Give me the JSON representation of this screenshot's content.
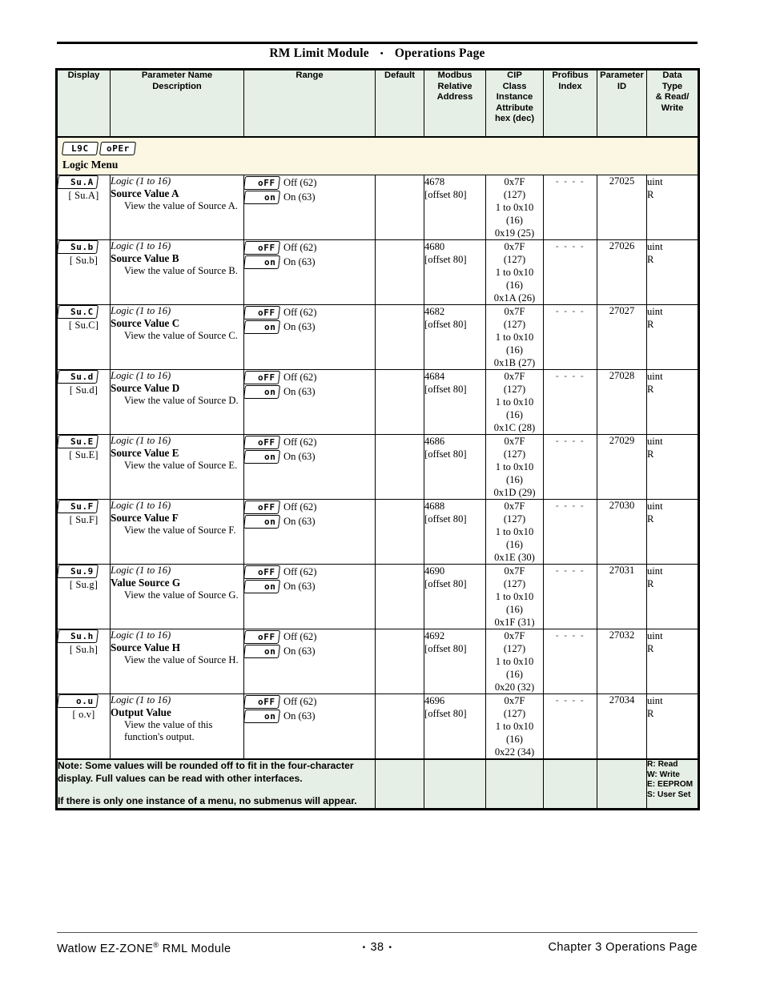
{
  "header": {
    "title_left": "RM Limit Module",
    "title_sep": "•",
    "title_right": "Operations Page"
  },
  "table": {
    "columns": [
      {
        "id": "display",
        "label": "Display"
      },
      {
        "id": "param",
        "label_line1": "Parameter Name",
        "label_line2": "Description"
      },
      {
        "id": "range",
        "label": "Range"
      },
      {
        "id": "default",
        "label": "Default"
      },
      {
        "id": "modbus",
        "label_line1": "Modbus",
        "label_line2": "Relative",
        "label_line3": "Address"
      },
      {
        "id": "cip",
        "label_line1": "CIP",
        "label_line2": "Class",
        "label_line3": "Instance",
        "label_line4": "Attribute",
        "label_line5": "hex (dec)"
      },
      {
        "id": "profibus",
        "label_line1": "Profibus",
        "label_line2": "Index"
      },
      {
        "id": "pid",
        "label_line1": "Parameter",
        "label_line2": "ID"
      },
      {
        "id": "dtype",
        "label_line1": "Data",
        "label_line2": "Type",
        "label_line3": "& Read/",
        "label_line4": "Write"
      }
    ],
    "menu_band": {
      "lcd_top": "L9C",
      "lcd_bottom": "oPEr",
      "label": "Logic Menu"
    },
    "rows": [
      {
        "lcd": "Su.A",
        "alt": "[ Su.A]",
        "logic": "Logic (1 to 16)",
        "name": "Source Value A",
        "desc": "View the value of Source A.",
        "range": [
          {
            "lcd": "oFF",
            "text": "Off (62)"
          },
          {
            "lcd": "on",
            "text": "On (63)"
          }
        ],
        "default": "",
        "modbus_address": "4678",
        "modbus_offset": "[offset 80]",
        "cip": [
          "0x7F",
          "(127)",
          "1 to 0x10",
          "(16)",
          "0x19 (25)"
        ],
        "profibus": "- - - -",
        "parameter_id": "27025",
        "dtype": "uint",
        "rw": "R"
      },
      {
        "lcd": "Su.b",
        "alt": "[ Su.b]",
        "logic": "Logic (1 to 16)",
        "name": "Source Value B",
        "desc": "View the value of Source B.",
        "range": [
          {
            "lcd": "oFF",
            "text": "Off (62)"
          },
          {
            "lcd": "on",
            "text": "On (63)"
          }
        ],
        "default": "",
        "modbus_address": "4680",
        "modbus_offset": "[offset 80]",
        "cip": [
          "0x7F",
          "(127)",
          "1 to 0x10",
          "(16)",
          "0x1A (26)"
        ],
        "profibus": "- - - -",
        "parameter_id": "27026",
        "dtype": "uint",
        "rw": "R"
      },
      {
        "lcd": "Su.C",
        "alt": "[ Su.C]",
        "logic": "Logic (1 to 16)",
        "name": "Source Value C",
        "desc": "View the value of Source C.",
        "range": [
          {
            "lcd": "oFF",
            "text": "Off (62)"
          },
          {
            "lcd": "on",
            "text": "On (63)"
          }
        ],
        "default": "",
        "modbus_address": "4682",
        "modbus_offset": "[offset 80]",
        "cip": [
          "0x7F",
          "(127)",
          "1 to 0x10",
          "(16)",
          "0x1B (27)"
        ],
        "profibus": "- - - -",
        "parameter_id": "27027",
        "dtype": "uint",
        "rw": "R"
      },
      {
        "lcd": "Su.d",
        "alt": "[ Su.d]",
        "logic": "Logic (1 to 16)",
        "name": "Source Value D",
        "desc": "View the value of Source D.",
        "range": [
          {
            "lcd": "oFF",
            "text": "Off (62)"
          },
          {
            "lcd": "on",
            "text": "On (63)"
          }
        ],
        "default": "",
        "modbus_address": "4684",
        "modbus_offset": "[offset 80]",
        "cip": [
          "0x7F",
          "(127)",
          "1 to 0x10",
          "(16)",
          "0x1C (28)"
        ],
        "profibus": "- - - -",
        "parameter_id": "27028",
        "dtype": "uint",
        "rw": "R"
      },
      {
        "lcd": "Su.E",
        "alt": "[ Su.E]",
        "logic": "Logic (1 to 16)",
        "name": "Source Value E",
        "desc": "View the value of Source E.",
        "range": [
          {
            "lcd": "oFF",
            "text": "Off (62)"
          },
          {
            "lcd": "on",
            "text": "On (63)"
          }
        ],
        "default": "",
        "modbus_address": "4686",
        "modbus_offset": "[offset 80]",
        "cip": [
          "0x7F",
          "(127)",
          "1 to 0x10",
          "(16)",
          "0x1D (29)"
        ],
        "profibus": "- - - -",
        "parameter_id": "27029",
        "dtype": "uint",
        "rw": "R"
      },
      {
        "lcd": "Su.F",
        "alt": "[ Su.F]",
        "logic": "Logic (1 to 16)",
        "name": "Source Value F",
        "desc": "View the value of Source F.",
        "range": [
          {
            "lcd": "oFF",
            "text": "Off (62)"
          },
          {
            "lcd": "on",
            "text": "On (63)"
          }
        ],
        "default": "",
        "modbus_address": "4688",
        "modbus_offset": "[offset 80]",
        "cip": [
          "0x7F",
          "(127)",
          "1 to 0x10",
          "(16)",
          "0x1E (30)"
        ],
        "profibus": "- - - -",
        "parameter_id": "27030",
        "dtype": "uint",
        "rw": "R"
      },
      {
        "lcd": "Su.9",
        "alt": "[ Su.g]",
        "logic": "Logic (1 to 16)",
        "name": "Value Source G",
        "desc": "View the value of Source G.",
        "range": [
          {
            "lcd": "oFF",
            "text": "Off (62)"
          },
          {
            "lcd": "on",
            "text": "On (63)"
          }
        ],
        "default": "",
        "modbus_address": "4690",
        "modbus_offset": "[offset 80]",
        "cip": [
          "0x7F",
          "(127)",
          "1 to 0x10",
          "(16)",
          "0x1F (31)"
        ],
        "profibus": "- - - -",
        "parameter_id": "27031",
        "dtype": "uint",
        "rw": "R"
      },
      {
        "lcd": "Su.h",
        "alt": "[ Su.h]",
        "logic": "Logic (1 to 16)",
        "name": "Source Value H",
        "desc": "View the value of Source H.",
        "range": [
          {
            "lcd": "oFF",
            "text": "Off (62)"
          },
          {
            "lcd": "on",
            "text": "On (63)"
          }
        ],
        "default": "",
        "modbus_address": "4692",
        "modbus_offset": "[offset 80]",
        "cip": [
          "0x7F",
          "(127)",
          "1 to 0x10",
          "(16)",
          "0x20 (32)"
        ],
        "profibus": "- - - -",
        "parameter_id": "27032",
        "dtype": "uint",
        "rw": "R"
      },
      {
        "lcd": "o.u",
        "alt": "[ o.v]",
        "logic": "Logic (1 to 16)",
        "name": "Output Value",
        "desc": "View the value of this function's output.",
        "range": [
          {
            "lcd": "oFF",
            "text": "Off (62)"
          },
          {
            "lcd": "on",
            "text": "On (63)"
          }
        ],
        "default": "",
        "modbus_address": "4696",
        "modbus_offset": "[offset 80]",
        "cip": [
          "0x7F",
          "(127)",
          "1 to 0x10",
          "(16)",
          "0x22 (34)"
        ],
        "profibus": "- - - -",
        "parameter_id": "27034",
        "dtype": "uint",
        "rw": "R"
      }
    ],
    "note": {
      "line1": "Note: Some values will be rounded off to fit in the four-character display. Full values can be read with other interfaces.",
      "line2": "If there is only one instance of a menu, no submenus will appear."
    },
    "legend": [
      "R: Read",
      "W: Write",
      "E: EEPROM",
      "S: User Set"
    ]
  },
  "footer": {
    "left_text": "Watlow EZ-ZONE",
    "left_sup": "®",
    "left_text2": " RML Module",
    "page_number": "38",
    "dot": "•",
    "right": "Chapter 3 Operations Page"
  },
  "colors": {
    "header_fill": "#e6efe6",
    "menu_fill": "#fcf7e3",
    "note_fill": "#e6efe6",
    "rule": "#000000"
  }
}
